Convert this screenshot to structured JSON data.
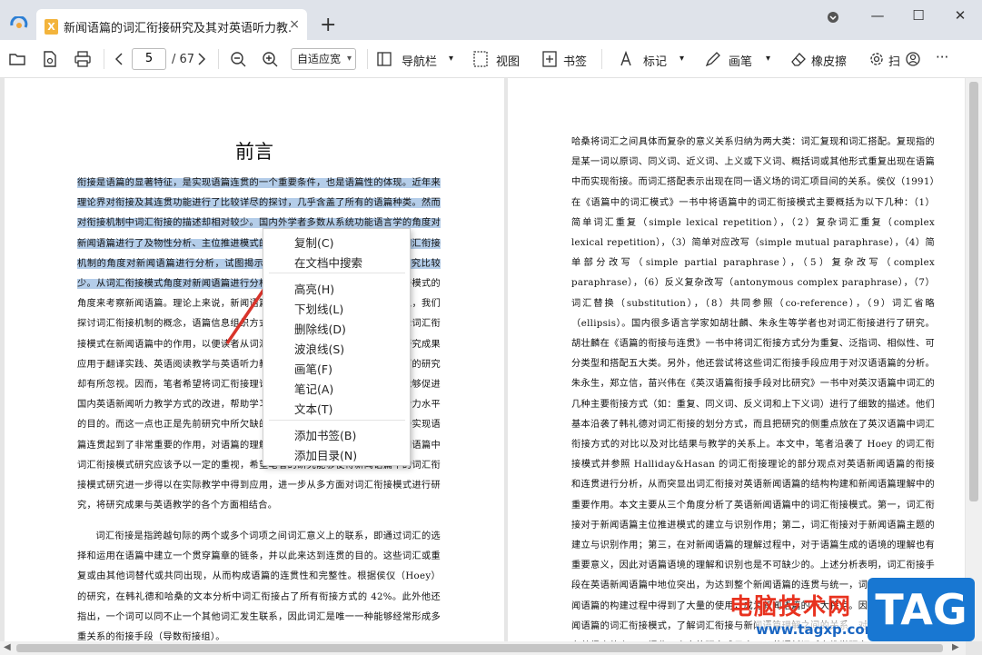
{
  "tab": {
    "title": "新闻语篇的词汇衔接研究及其对英语听力教...",
    "icon_text": "X",
    "close": "×",
    "new_tab": "+"
  },
  "window": {
    "minimize": "—",
    "maximize": "☐",
    "close": "✕"
  },
  "toolbar": {
    "page_current": "5",
    "page_total": "/ 67",
    "zoom": "自适应宽",
    "nav_label": "导航栏",
    "view_label": "视图",
    "bookmark_label": "书签",
    "mark_label": "标记",
    "pen_label": "画笔",
    "eraser_label": "橡皮擦",
    "truncated_label": "扫",
    "more": "···"
  },
  "left_page": {
    "heading": "前言",
    "para1_selected": "衔接是语篇的显著特征，是实现语篇连贯的一个重要条件，也是语篇性的体现。近年来理论界对衔接及其连贯功能进行了比较详尽的探讨，几乎含盖了所有的语篇种类。然而对衔接机制中词汇衔接的描述却相对较少。国内外学者多数从系统功能语言学的角度对新闻语篇进行了及物性分析、主位推进模式的分析以及评价系统的分析等，从词汇衔接机制的角度对新闻语篇进行分析，试图揭示衔接机制在新闻语篇中的作用的研究比较少。从词汇衔接模式角度对新闻语篇进行分析的研究并不多。",
    "para1_rest": "全面分析词汇衔接模式的角度来考察新闻语篇。理论上来说，新闻语篇的性质决定了语篇性的实现。所以，我们探讨词汇衔接机制的概念，语篇信息组织方式和实现语篇连贯的关系，进而讨论词汇衔接模式在新闻语篇中的作用，以便读者从词汇衔接的角度研究新闻语篇，并把研究成果应用于翻译实践、英语阅读教学与英语听力教学等。对于英语新闻听力教学方面的研究却有所忽视。因而，笔者希望将词汇衔接理论应用于英语新闻听力教学，期望能够促进国内英语新闻听力教学方式的改进，帮助学习者提高新闻听力技能和提高新闻听力水平的目的。而这一点也正是先前研究中所欠缺的。本研究认为，词汇衔接模式对于实现语篇连贯起到了非常重要的作用，对语篇的理解也有着重要意义。因此，英语新闻语篇中词汇衔接模式研究应该予以一定的重视，希望笔者的研究能够使得新闻语篇中的词汇衔接模式研究进一步得以在实际教学中得到应用，进一步从多方面对词汇衔接模式进行研究，将研究成果与英语教学的各个方面相结合。",
    "para2": "词汇衔接是指跨越句际的两个或多个词项之间词汇意义上的联系，即通过词汇的选择和运用在语篇中建立一个贯穿篇章的链条，并以此来达到连贯的目的。这些词汇或重复或由其他词替代或共同出现，从而构成语篇的连贯性和完整性。根据侯仪（Hoey）的研究，在韩礼德和哈桑的文本分析中词汇衔接占了所有衔接方式的 42%。此外他还指出，一个词可以同不止一个其他词汇发生联系，因此词汇是唯一一种能够经常形成多重关系的衔接手段（导数衔接组）。"
  },
  "right_page": {
    "text": "哈桑将词汇之间具体而复杂的意义关系归纳为两大类：词汇复现和词汇搭配。复现指的是某一词以原词、同义词、近义词、上义或下义词、概括词或其他形式重复出现在语篇中而实现衔接。而词汇搭配表示出现在同一语义场的词汇项目间的关系。侯仪（1991）在《语篇中的词汇模式》一书中将语篇中的词汇衔接模式主要概括为以下几种：（1）简单词汇重复（simple lexical repetition），（2）复杂词汇重复（complex lexical repetition），（3）简单对应改写（simple mutual paraphrase），（4）简单部分改写（simple partial paraphrase），（5）复杂改写（complex paraphrase），（6）反义复杂改写（antonymous complex paraphrase），（7）词汇替换（substitution），（8）共同参照（co-reference），（9）词汇省略（ellipsis）。国内很多语言学家如胡壮麟、朱永生等学者也对词汇衔接进行了研究。胡壮麟在《语篇的衔接与连贯》一书中将词汇衔接方式分为重复、泛指词、相似性、可分类型和搭配五大类。另外，他还尝试将这些词汇衔接手段应用于对汉语语篇的分析。朱永生，郑立信，苗兴伟在《英汉语篇衔接手段对比研究》一书中对英汉语篇中词汇的几种主要衔接方式（如：重复、同义词、反义词和上下义词）进行了细致的描述。他们基本沿袭了韩礼德对词汇衔接的划分方式，而且把研究的侧重点放在了英汉语篇中词汇衔接方式的对比以及对比结果与教学的关系上。本文中，笔者沿袭了 Hoey 的词汇衔接模式并参照 Halliday&Hasan 的词汇衔接理论的部分观点对英语新闻语篇的衔接和连贯进行分析，从而突显出词汇衔接对英语新闻语篇的结构构建和新闻语篇理解中的重要作用。本文主要从三个角度分析了英语新闻语篇中的词汇衔接模式。第一，词汇衔接对于新闻语篇主位推进模式的建立与识别作用；第二，词汇衔接对于新闻语篇主题的建立与识别作用；第三，在对新闻语篇的理解过程中，对于语篇生成的语境的理解也有重要意义，因此对语篇语境的理解和识别也是不可缺少的。上述分析表明，词汇衔接手段在英语新闻语篇中地位突出，为达到整个新闻语篇的连贯与统一，词汇衔接手段在新闻语篇的构建过程中得到了大量的使用，成为新闻语篇的一大特点。因此，分析英语新闻语篇的词汇衔接模式，了解词汇衔接与新闻语篇理解之间的关系，对于英语听力教学有着很大的启示。据此，本文将研究成果应用于英语新闻听力教学研究，提出了相关建议。"
  },
  "context_menu": {
    "items": [
      "复制(C)",
      "在文档中搜索",
      "高亮(H)",
      "下划线(L)",
      "删除线(D)",
      "波浪线(S)",
      "画笔(F)",
      "笔记(A)",
      "文本(T)",
      "添加书签(B)",
      "添加目录(N)"
    ]
  },
  "watermark": {
    "title": "电脑技术网",
    "url": "www.tagxp.com",
    "tag": "TAG"
  },
  "colors": {
    "selection": "#b4cde9",
    "arrow": "#d9342b",
    "watermark_red": "#e8321f",
    "watermark_blue": "#1877d2"
  }
}
